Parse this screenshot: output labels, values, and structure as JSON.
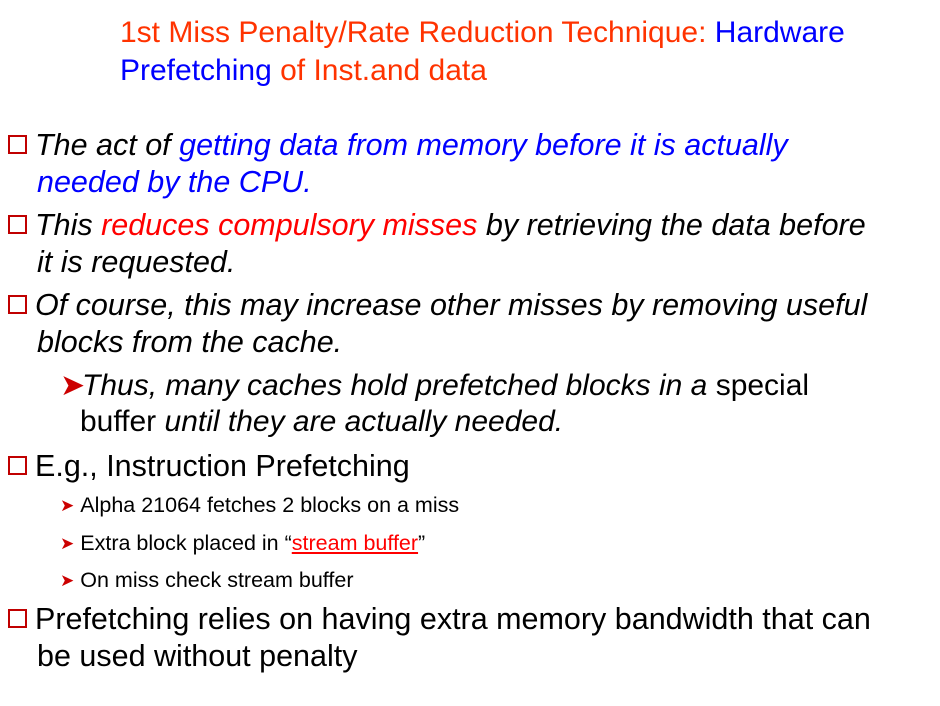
{
  "title": {
    "part1": "1st Miss Penalty/Rate Reduction Technique: ",
    "part2": "Hardware",
    "part3": "Prefetching",
    "part4": " of Inst.and data"
  },
  "bullets": {
    "b1": {
      "part1": "The act of ",
      "part2": "getting data from memory before it is actually",
      "line2": "needed by the CPU."
    },
    "b2": {
      "part1": "This ",
      "part2": "reduces compulsory misses",
      "part3": " by retrieving the data before",
      "line2": "it is requested."
    },
    "b3": {
      "line1": "Of course, this may increase other misses by removing useful",
      "line2": "blocks from the cache."
    },
    "b3_sub": {
      "part1": "Thus, many caches hold prefetched blocks in a ",
      "part2": "special",
      "line2a": "buffer ",
      "line2b": "until they are actually needed."
    },
    "b4": {
      "text": "E.g., Instruction Prefetching"
    },
    "b4_subs": {
      "s1": "Alpha 21064 fetches 2 blocks on a miss",
      "s2a": "Extra block placed in “",
      "s2b": "stream buffer",
      "s2c": "”",
      "s3": "On miss check stream buffer"
    },
    "b5": {
      "line1": "Prefetching relies on having extra memory bandwidth that can",
      "line2": "be used without penalty"
    }
  },
  "icons": {
    "bullet": "hollow-square-icon",
    "sub_bullet": "arrowhead-icon"
  },
  "colors": {
    "title_red": "#ff3300",
    "title_blue": "#0000ff",
    "text_blue": "#0000ff",
    "text_red": "#ff0000",
    "bullet_box": "#c00000"
  }
}
